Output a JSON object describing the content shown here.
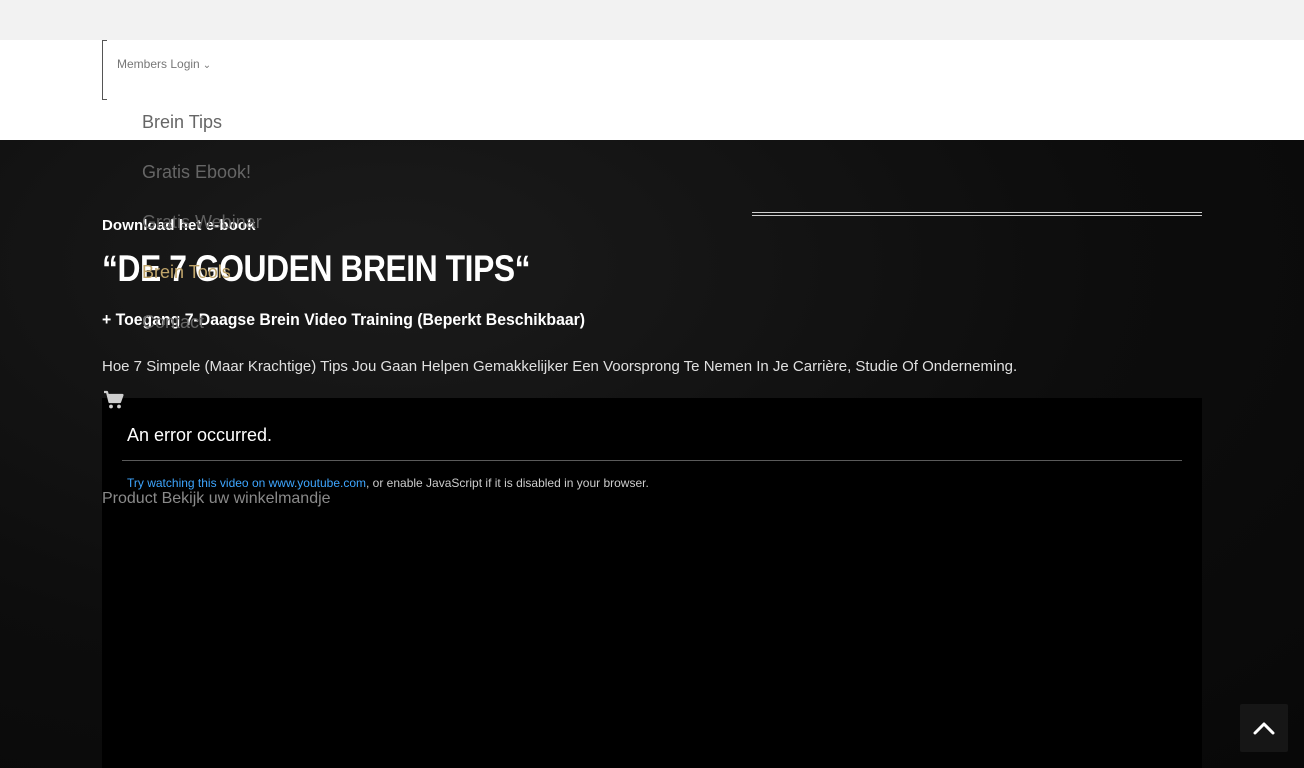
{
  "header": {
    "members_login": "Members Login",
    "members_login_icon": "chevron-down-icon"
  },
  "nav": {
    "items": [
      {
        "label": "Brein Tips"
      },
      {
        "label": "Gratis Ebook!"
      },
      {
        "label": "Gratis Webinar"
      },
      {
        "label": "Brein Tools"
      },
      {
        "label": "Contact"
      }
    ],
    "active_color": "#bfa46a"
  },
  "hero": {
    "download_label": "Download het e-book",
    "title": "“DE 7 GOUDEN BREIN TIPS“",
    "subtitle": "+ Toegang 7-Daagse Brein Video Training (Beperkt Beschikbaar)",
    "description": "Hoe 7 Simpele (Maar Krachtige) Tips Jou Gaan Helpen Gemakkelijker Een Voorsprong Te Nemen In Je Carrière, Studie Of Onderneming."
  },
  "cart": {
    "icon": "cart-icon",
    "text": "Product Bekijk uw winkelmandje"
  },
  "video": {
    "error_title": "An error occurred.",
    "link_text": "Try watching this video on www.youtube.com",
    "error_suffix": ", or enable JavaScript if it is disabled in your browser."
  },
  "scroll_top": {
    "icon": "chevron-up-icon"
  }
}
